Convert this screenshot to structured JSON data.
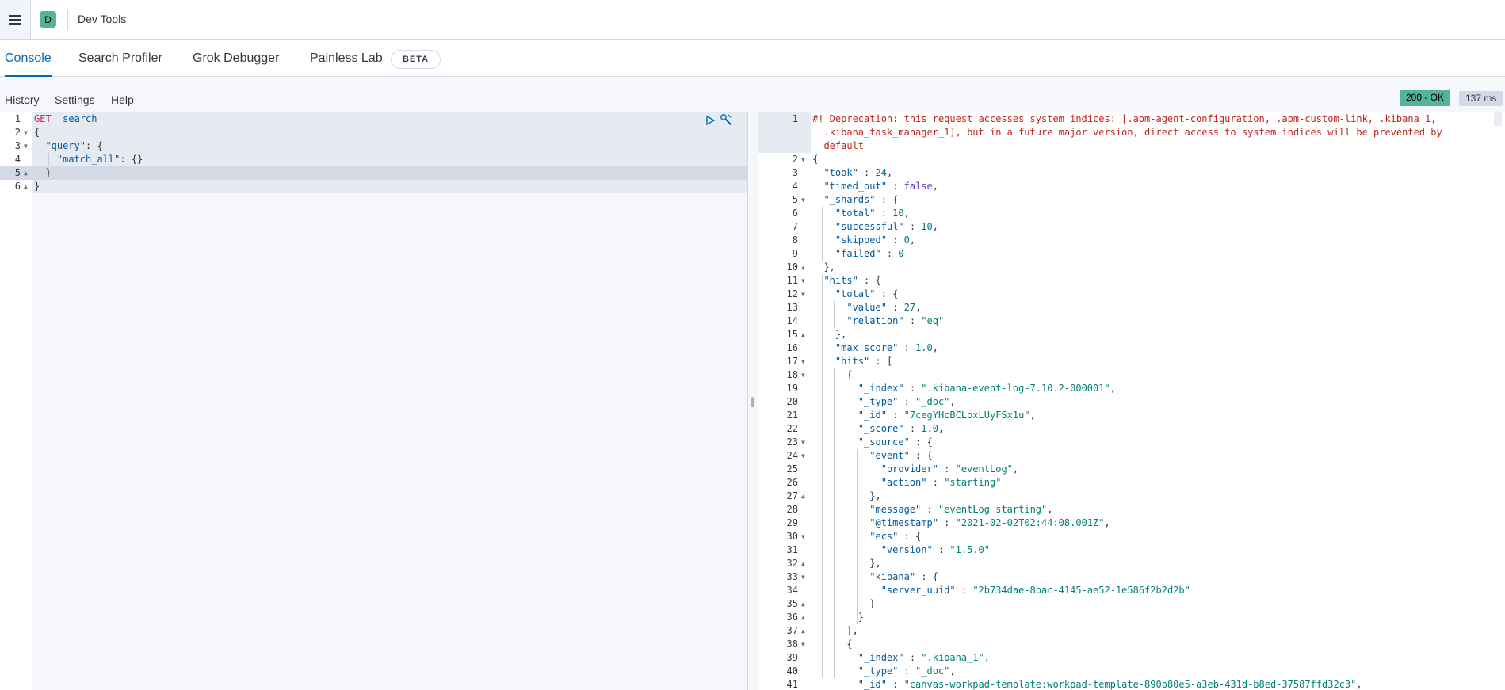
{
  "header": {
    "space_initial": "D",
    "breadcrumb": "Dev Tools"
  },
  "tabs": [
    {
      "label": "Console",
      "active": true
    },
    {
      "label": "Search Profiler",
      "active": false
    },
    {
      "label": "Grok Debugger",
      "active": false
    },
    {
      "label": "Painless Lab",
      "active": false
    }
  ],
  "beta_label": "BETA",
  "toolbar": {
    "history": "History",
    "settings": "Settings",
    "help": "Help",
    "status": "200 - OK",
    "time": "137 ms"
  },
  "request": {
    "lines": [
      {
        "num": "1",
        "fold": "",
        "text": [
          [
            "m",
            "GET"
          ],
          [
            "p",
            " "
          ],
          [
            "k",
            "_search"
          ]
        ]
      },
      {
        "num": "2",
        "fold": "▼",
        "text": [
          [
            "p",
            "{"
          ]
        ]
      },
      {
        "num": "3",
        "fold": "▼",
        "text": [
          [
            "p",
            "  "
          ],
          [
            "k",
            "\"query\""
          ],
          [
            "p",
            ": {"
          ]
        ]
      },
      {
        "num": "4",
        "fold": "",
        "text": [
          [
            "p",
            "    "
          ],
          [
            "k",
            "\"match_all\""
          ],
          [
            "p",
            ": {}"
          ]
        ]
      },
      {
        "num": "5",
        "fold": "▲",
        "text": [
          [
            "p",
            "  }"
          ]
        ]
      },
      {
        "num": "6",
        "fold": "▲",
        "text": [
          [
            "p",
            "}"
          ]
        ]
      }
    ]
  },
  "response": {
    "warning_lines": [
      "#! Deprecation: this request accesses system indices: [.apm-agent-configuration, .apm-custom-link, .kibana_1,",
      "  .kibana_task_manager_1], but in a future major version, direct access to system indices will be prevented by",
      "  default"
    ],
    "lines": [
      {
        "num": "2",
        "fold": "▼",
        "text": [
          [
            "p",
            "{"
          ]
        ]
      },
      {
        "num": "3",
        "fold": "",
        "text": [
          [
            "p",
            "  "
          ],
          [
            "k",
            "\"took\""
          ],
          [
            "p",
            " : "
          ],
          [
            "n",
            "24"
          ],
          [
            "p",
            ","
          ]
        ]
      },
      {
        "num": "4",
        "fold": "",
        "text": [
          [
            "p",
            "  "
          ],
          [
            "k",
            "\"timed_out\""
          ],
          [
            "p",
            " : "
          ],
          [
            "b",
            "false"
          ],
          [
            "p",
            ","
          ]
        ]
      },
      {
        "num": "5",
        "fold": "▼",
        "text": [
          [
            "p",
            "  "
          ],
          [
            "k",
            "\"_shards\""
          ],
          [
            "p",
            " : {"
          ]
        ]
      },
      {
        "num": "6",
        "fold": "",
        "text": [
          [
            "p",
            "    "
          ],
          [
            "k",
            "\"total\""
          ],
          [
            "p",
            " : "
          ],
          [
            "n",
            "10"
          ],
          [
            "p",
            ","
          ]
        ]
      },
      {
        "num": "7",
        "fold": "",
        "text": [
          [
            "p",
            "    "
          ],
          [
            "k",
            "\"successful\""
          ],
          [
            "p",
            " : "
          ],
          [
            "n",
            "10"
          ],
          [
            "p",
            ","
          ]
        ]
      },
      {
        "num": "8",
        "fold": "",
        "text": [
          [
            "p",
            "    "
          ],
          [
            "k",
            "\"skipped\""
          ],
          [
            "p",
            " : "
          ],
          [
            "n",
            "0"
          ],
          [
            "p",
            ","
          ]
        ]
      },
      {
        "num": "9",
        "fold": "",
        "text": [
          [
            "p",
            "    "
          ],
          [
            "k",
            "\"failed\""
          ],
          [
            "p",
            " : "
          ],
          [
            "n",
            "0"
          ]
        ]
      },
      {
        "num": "10",
        "fold": "▲",
        "text": [
          [
            "p",
            "  },"
          ]
        ]
      },
      {
        "num": "11",
        "fold": "▼",
        "text": [
          [
            "p",
            "  "
          ],
          [
            "k",
            "\"hits\""
          ],
          [
            "p",
            " : {"
          ]
        ]
      },
      {
        "num": "12",
        "fold": "▼",
        "text": [
          [
            "p",
            "    "
          ],
          [
            "k",
            "\"total\""
          ],
          [
            "p",
            " : {"
          ]
        ]
      },
      {
        "num": "13",
        "fold": "",
        "text": [
          [
            "p",
            "      "
          ],
          [
            "k",
            "\"value\""
          ],
          [
            "p",
            " : "
          ],
          [
            "n",
            "27"
          ],
          [
            "p",
            ","
          ]
        ]
      },
      {
        "num": "14",
        "fold": "",
        "text": [
          [
            "p",
            "      "
          ],
          [
            "k",
            "\"relation\""
          ],
          [
            "p",
            " : "
          ],
          [
            "s",
            "\"eq\""
          ]
        ]
      },
      {
        "num": "15",
        "fold": "▲",
        "text": [
          [
            "p",
            "    },"
          ]
        ]
      },
      {
        "num": "16",
        "fold": "",
        "text": [
          [
            "p",
            "    "
          ],
          [
            "k",
            "\"max_score\""
          ],
          [
            "p",
            " : "
          ],
          [
            "n",
            "1.0"
          ],
          [
            "p",
            ","
          ]
        ]
      },
      {
        "num": "17",
        "fold": "▼",
        "text": [
          [
            "p",
            "    "
          ],
          [
            "k",
            "\"hits\""
          ],
          [
            "p",
            " : ["
          ]
        ]
      },
      {
        "num": "18",
        "fold": "▼",
        "text": [
          [
            "p",
            "      {"
          ]
        ]
      },
      {
        "num": "19",
        "fold": "",
        "text": [
          [
            "p",
            "        "
          ],
          [
            "k",
            "\"_index\""
          ],
          [
            "p",
            " : "
          ],
          [
            "s",
            "\".kibana-event-log-7.10.2-000001\""
          ],
          [
            "p",
            ","
          ]
        ]
      },
      {
        "num": "20",
        "fold": "",
        "text": [
          [
            "p",
            "        "
          ],
          [
            "k",
            "\"_type\""
          ],
          [
            "p",
            " : "
          ],
          [
            "s",
            "\"_doc\""
          ],
          [
            "p",
            ","
          ]
        ]
      },
      {
        "num": "21",
        "fold": "",
        "text": [
          [
            "p",
            "        "
          ],
          [
            "k",
            "\"_id\""
          ],
          [
            "p",
            " : "
          ],
          [
            "s",
            "\"7cegYHcBCLoxLUyFSx1u\""
          ],
          [
            "p",
            ","
          ]
        ]
      },
      {
        "num": "22",
        "fold": "",
        "text": [
          [
            "p",
            "        "
          ],
          [
            "k",
            "\"_score\""
          ],
          [
            "p",
            " : "
          ],
          [
            "n",
            "1.0"
          ],
          [
            "p",
            ","
          ]
        ]
      },
      {
        "num": "23",
        "fold": "▼",
        "text": [
          [
            "p",
            "        "
          ],
          [
            "k",
            "\"_source\""
          ],
          [
            "p",
            " : {"
          ]
        ]
      },
      {
        "num": "24",
        "fold": "▼",
        "text": [
          [
            "p",
            "          "
          ],
          [
            "k",
            "\"event\""
          ],
          [
            "p",
            " : {"
          ]
        ]
      },
      {
        "num": "25",
        "fold": "",
        "text": [
          [
            "p",
            "            "
          ],
          [
            "k",
            "\"provider\""
          ],
          [
            "p",
            " : "
          ],
          [
            "s",
            "\"eventLog\""
          ],
          [
            "p",
            ","
          ]
        ]
      },
      {
        "num": "26",
        "fold": "",
        "text": [
          [
            "p",
            "            "
          ],
          [
            "k",
            "\"action\""
          ],
          [
            "p",
            " : "
          ],
          [
            "s",
            "\"starting\""
          ]
        ]
      },
      {
        "num": "27",
        "fold": "▲",
        "text": [
          [
            "p",
            "          },"
          ]
        ]
      },
      {
        "num": "28",
        "fold": "",
        "text": [
          [
            "p",
            "          "
          ],
          [
            "k",
            "\"message\""
          ],
          [
            "p",
            " : "
          ],
          [
            "s",
            "\"eventLog starting\""
          ],
          [
            "p",
            ","
          ]
        ]
      },
      {
        "num": "29",
        "fold": "",
        "text": [
          [
            "p",
            "          "
          ],
          [
            "k",
            "\"@timestamp\""
          ],
          [
            "p",
            " : "
          ],
          [
            "s",
            "\"2021-02-02T02:44:08.001Z\""
          ],
          [
            "p",
            ","
          ]
        ]
      },
      {
        "num": "30",
        "fold": "▼",
        "text": [
          [
            "p",
            "          "
          ],
          [
            "k",
            "\"ecs\""
          ],
          [
            "p",
            " : {"
          ]
        ]
      },
      {
        "num": "31",
        "fold": "",
        "text": [
          [
            "p",
            "            "
          ],
          [
            "k",
            "\"version\""
          ],
          [
            "p",
            " : "
          ],
          [
            "s",
            "\"1.5.0\""
          ]
        ]
      },
      {
        "num": "32",
        "fold": "▲",
        "text": [
          [
            "p",
            "          },"
          ]
        ]
      },
      {
        "num": "33",
        "fold": "▼",
        "text": [
          [
            "p",
            "          "
          ],
          [
            "k",
            "\"kibana\""
          ],
          [
            "p",
            " : {"
          ]
        ]
      },
      {
        "num": "34",
        "fold": "",
        "text": [
          [
            "p",
            "            "
          ],
          [
            "k",
            "\"server_uuid\""
          ],
          [
            "p",
            " : "
          ],
          [
            "s",
            "\"2b734dae-8bac-4145-ae52-1e586f2b2d2b\""
          ]
        ]
      },
      {
        "num": "35",
        "fold": "▲",
        "text": [
          [
            "p",
            "          }"
          ]
        ]
      },
      {
        "num": "36",
        "fold": "▲",
        "text": [
          [
            "p",
            "        }"
          ]
        ]
      },
      {
        "num": "37",
        "fold": "▲",
        "text": [
          [
            "p",
            "      },"
          ]
        ]
      },
      {
        "num": "38",
        "fold": "▼",
        "text": [
          [
            "p",
            "      {"
          ]
        ]
      },
      {
        "num": "39",
        "fold": "",
        "text": [
          [
            "p",
            "        "
          ],
          [
            "k",
            "\"_index\""
          ],
          [
            "p",
            " : "
          ],
          [
            "s",
            "\".kibana_1\""
          ],
          [
            "p",
            ","
          ]
        ]
      },
      {
        "num": "40",
        "fold": "",
        "text": [
          [
            "p",
            "        "
          ],
          [
            "k",
            "\"_type\""
          ],
          [
            "p",
            " : "
          ],
          [
            "s",
            "\"_doc\""
          ],
          [
            "p",
            ","
          ]
        ]
      },
      {
        "num": "41",
        "fold": "",
        "text": [
          [
            "p",
            "        "
          ],
          [
            "k",
            "\"_id\""
          ],
          [
            "p",
            " : "
          ],
          [
            "s",
            "\"canvas-workpad-template:workpad-template-890b80e5-a3eb-431d-b8ed-37587ffd32c3\""
          ],
          [
            "p",
            ","
          ]
        ]
      }
    ]
  }
}
